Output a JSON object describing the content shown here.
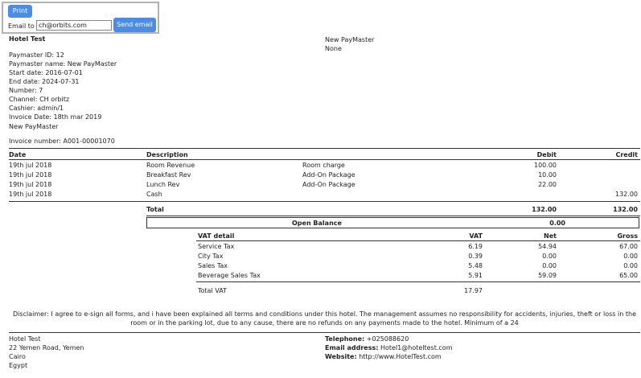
{
  "toolbar": {
    "print_label": "Print",
    "email_label": "Email to :",
    "email_value": "ch@orbits.com",
    "send_label": "Send email"
  },
  "hotel_name": "Hotel Test",
  "paymaster_block": {
    "id": "Paymaster ID: 12",
    "name": "Paymaster name: New PayMaster",
    "start": "Start date: 2016-07-01",
    "end": "End date: 2024-07-31",
    "number": "Number: 7",
    "channel": "Channel: CH orbitz",
    "cashier": "Cashier: admin/1",
    "invoice_date": "Invoice Date: 18th mar 2019",
    "name2": "New PayMaster",
    "invoice_number": "Invoice number: A001-00001070"
  },
  "right_block": {
    "line1": "New PayMaster",
    "line2": "None"
  },
  "table": {
    "headers": {
      "date": "Date",
      "description": "Description",
      "debit": "Debit",
      "credit": "Credit"
    },
    "rows": [
      {
        "date": "19th jul 2018",
        "desc": "Room Revenue",
        "detail": "Room charge",
        "debit": "100.00",
        "credit": ""
      },
      {
        "date": "19th jul 2018",
        "desc": "Breakfast Rev",
        "detail": "Add-On Package",
        "debit": "10.00",
        "credit": ""
      },
      {
        "date": "19th jul 2018",
        "desc": "Lunch Rev",
        "detail": "Add-On Package",
        "debit": "22.00",
        "credit": ""
      },
      {
        "date": "19th jul 2018",
        "desc": "Cash",
        "detail": "",
        "debit": "",
        "credit": "132.00"
      }
    ],
    "total_label": "Total",
    "total_debit": "132.00",
    "total_credit": "132.00",
    "open_balance_label": "Open Balance",
    "open_balance_value": "0.00"
  },
  "vat": {
    "headers": {
      "detail": "VAT detail",
      "vat": "VAT",
      "net": "Net",
      "gross": "Gross"
    },
    "rows": [
      {
        "name": "Service Tax",
        "vat": "6.19",
        "net": "54.94",
        "gross": "67.00"
      },
      {
        "name": "City Tax",
        "vat": "0.39",
        "net": "0.00",
        "gross": "0.00"
      },
      {
        "name": "Sales Tax",
        "vat": "5.48",
        "net": "0.00",
        "gross": "0.00"
      },
      {
        "name": "Beverage Sales Tax",
        "vat": "5.91",
        "net": "59.09",
        "gross": "65.00"
      }
    ],
    "total_label": "Total VAT",
    "total_value": "17.97"
  },
  "disclaimer": "Disclaimer: I agree to e-sign all forms, and i have been explained all terms and conditions under this hotel. The management assumes no responsibility for accidents, injuries, theft or loss in the room or in the parking lot, due to any cause, there are no refunds on any payments made to the hotel. Minimum of a 24",
  "footer": {
    "address": [
      "Hotel Test",
      "22 Yemen Road, Yemen",
      "Cairo",
      "Egypt"
    ],
    "telephone_label": "Telephone:",
    "telephone": "+025088620",
    "email_label": "Email address:",
    "email": "Hotel1@hoteltest.com",
    "website_label": "Website:",
    "website": "http://www.HotelTest.com"
  }
}
